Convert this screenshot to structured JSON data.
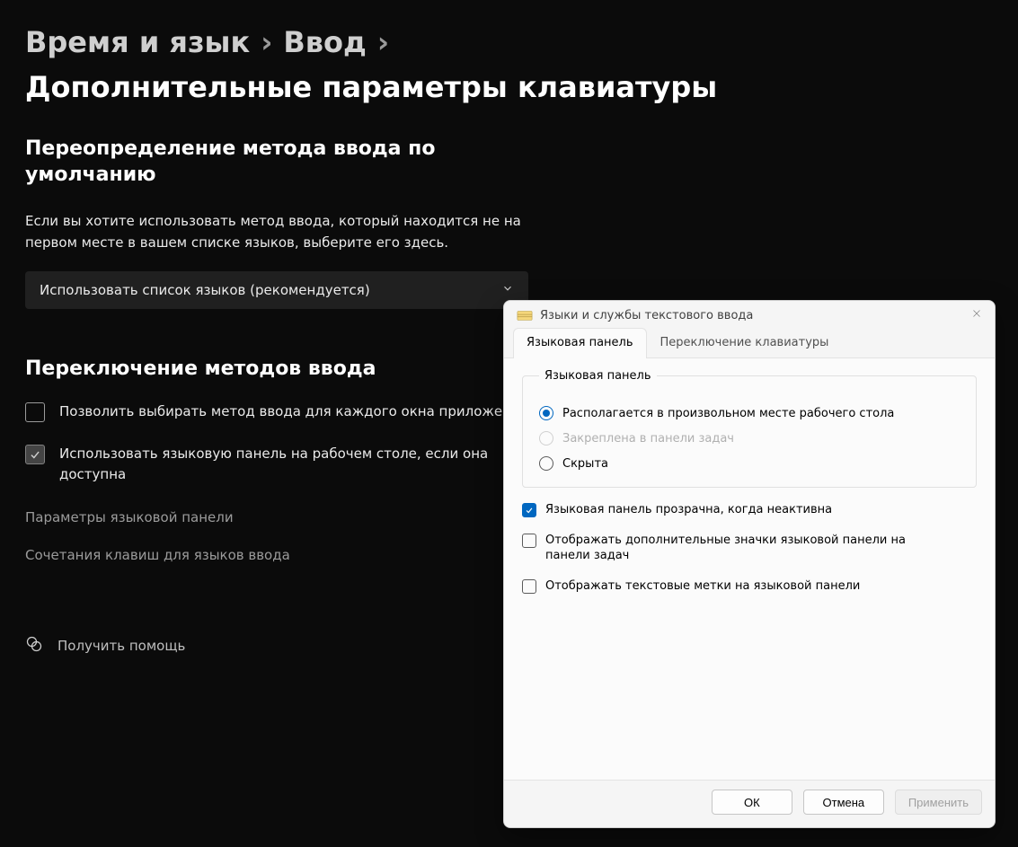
{
  "breadcrumb": {
    "l1": "Время и язык",
    "l2": "Ввод",
    "current": "Дополнительные параметры клавиатуры"
  },
  "section1": {
    "heading": "Переопределение метода ввода по умолчанию",
    "desc": "Если вы хотите использовать метод ввода, который находится не на первом месте в вашем списке языков, выберите его здесь.",
    "dropdown_value": "Использовать список языков (рекомендуется)"
  },
  "section2": {
    "heading": "Переключение методов ввода",
    "check1": "Позволить выбирать метод ввода для каждого окна приложения",
    "check1_state": false,
    "check2": "Использовать языковую панель на рабочем столе, если она доступна",
    "check2_state": true,
    "link1": "Параметры языковой панели",
    "link2": "Сочетания клавиш для языков ввода"
  },
  "help": {
    "label": "Получить помощь"
  },
  "dialog": {
    "title": "Языки и службы текстового ввода",
    "tab1": "Языковая панель",
    "tab2": "Переключение клавиатуры",
    "group_legend": "Языковая панель",
    "radio1": "Располагается в произвольном месте рабочего стола",
    "radio2": "Закреплена в панели задач",
    "radio3": "Скрыта",
    "radio_selected": 1,
    "c1": "Языковая панель прозрачна, когда неактивна",
    "c2": "Отображать дополнительные значки языковой панели на панели задач",
    "c3": "Отображать текстовые метки на языковой панели",
    "footer_ok": "ОК",
    "footer_cancel": "Отмена",
    "footer_apply": "Применить"
  }
}
